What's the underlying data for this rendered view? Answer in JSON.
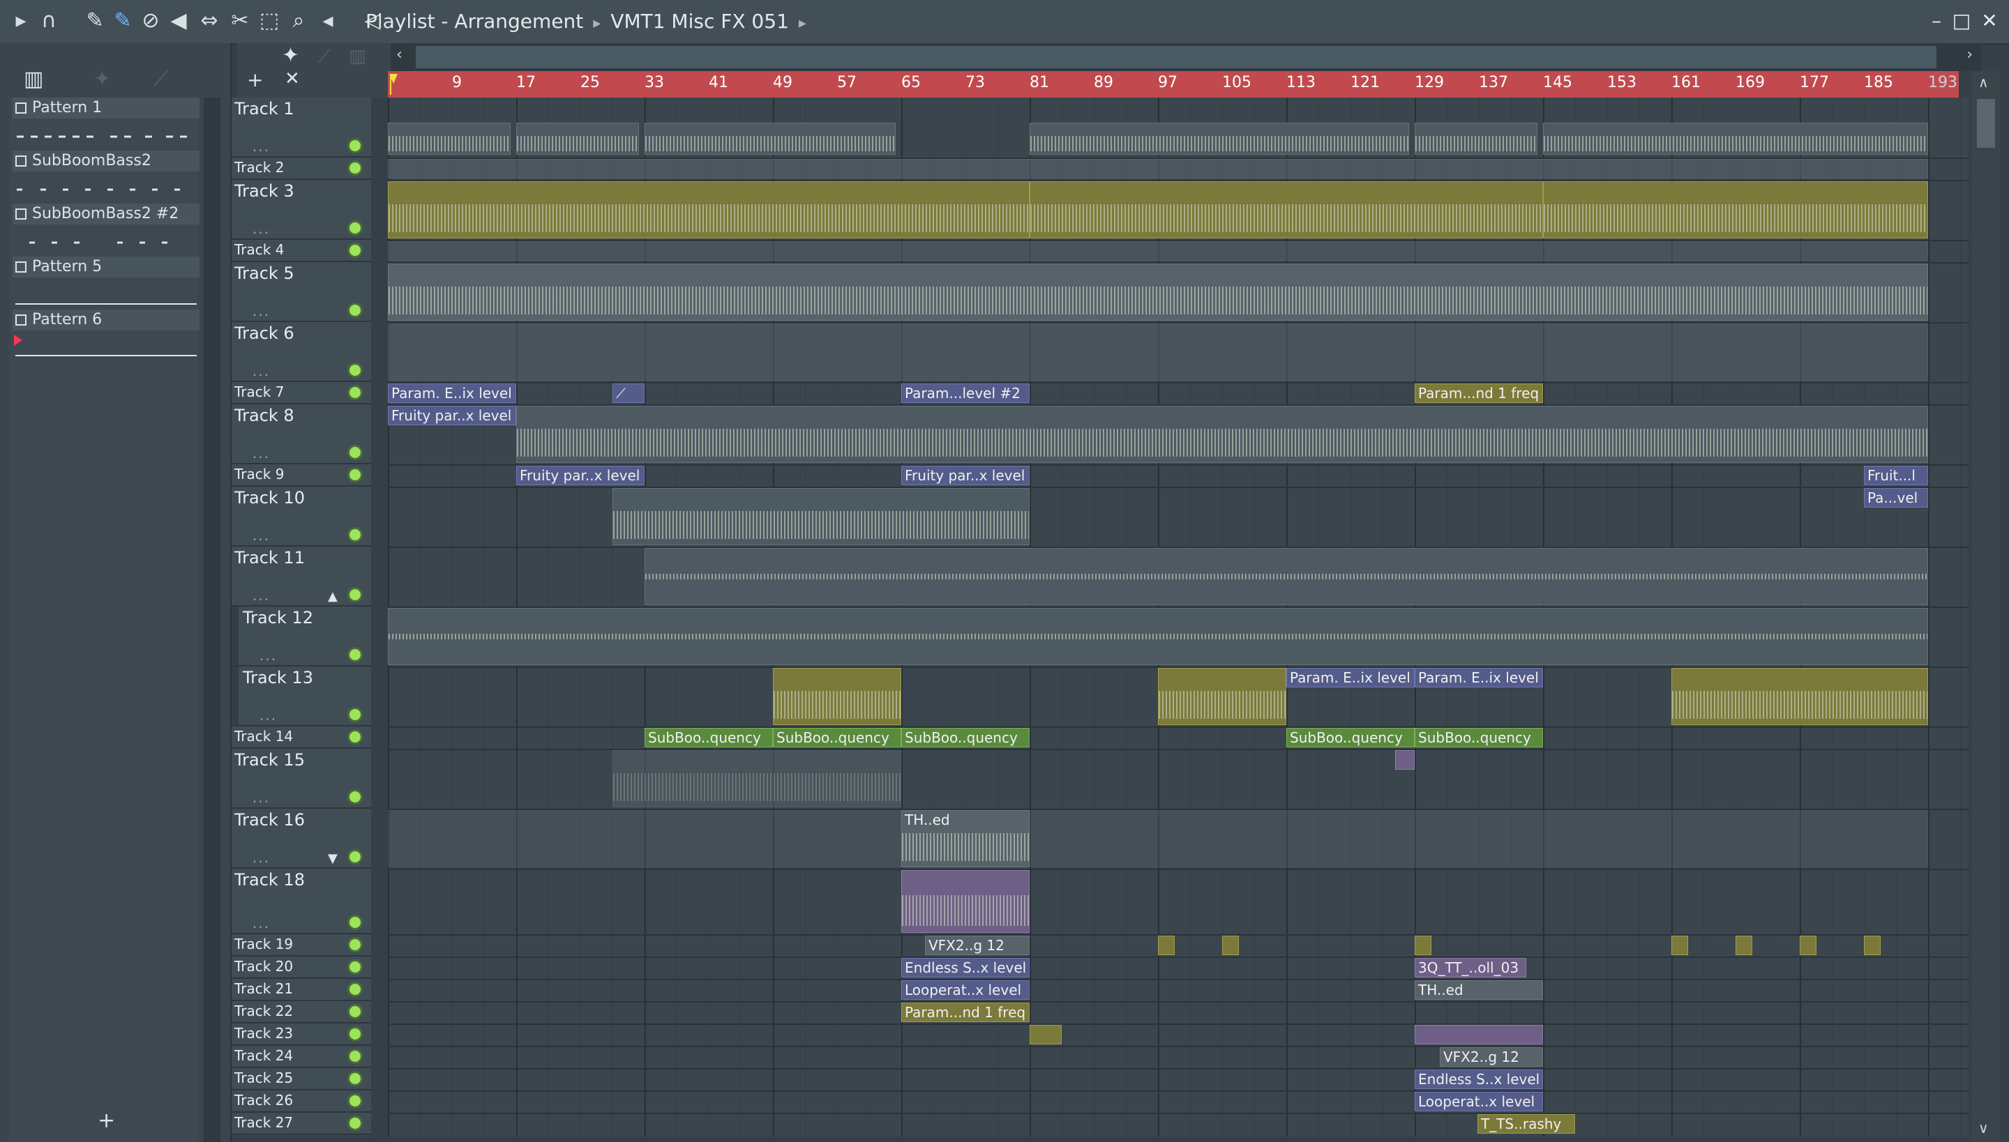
{
  "window": {
    "breadcrumb": [
      "Playlist - Arrangement",
      "VMT1 Misc FX 051"
    ],
    "controls": [
      "minimize",
      "maximize",
      "close"
    ]
  },
  "toolbar_icons": [
    "play-arrow-icon",
    "magnet-icon",
    "pencil-icon",
    "brush-icon",
    "delete-icon",
    "mute-icon",
    "slip-icon",
    "slice-icon",
    "select-icon",
    "zoom-icon",
    "playback-icon",
    "speaker-icon"
  ],
  "browser": {
    "patterns": [
      {
        "label": "Pattern 1"
      },
      {
        "label": "SubBoomBass2"
      },
      {
        "label": "SubBoomBass2 #2"
      },
      {
        "label": "Pattern 5"
      },
      {
        "label": "Pattern 6"
      }
    ],
    "add_label": "+"
  },
  "ruler": {
    "bars": [
      "9",
      "17",
      "25",
      "33",
      "41",
      "49",
      "57",
      "65",
      "73",
      "81",
      "89",
      "97",
      "105",
      "113",
      "121",
      "129",
      "137",
      "145",
      "153",
      "161",
      "169",
      "177",
      "185",
      "193"
    ]
  },
  "tracks": [
    {
      "label": "Track 1"
    },
    {
      "label": "Track 2"
    },
    {
      "label": "Track 3"
    },
    {
      "label": "Track 4"
    },
    {
      "label": "Track 5"
    },
    {
      "label": "Track 6"
    },
    {
      "label": "Track 7"
    },
    {
      "label": "Track 8"
    },
    {
      "label": "Track 9"
    },
    {
      "label": "Track 10"
    },
    {
      "label": "Track 11"
    },
    {
      "label": "Track 12"
    },
    {
      "label": "Track 13"
    },
    {
      "label": "Track 14"
    },
    {
      "label": "Track 15"
    },
    {
      "label": "Track 16"
    },
    {
      "label": "Track 18"
    },
    {
      "label": "Track 19"
    },
    {
      "label": "Track 20"
    },
    {
      "label": "Track 21"
    },
    {
      "label": "Track 22"
    },
    {
      "label": "Track 23"
    },
    {
      "label": "Track 24"
    },
    {
      "label": "Track 25"
    },
    {
      "label": "Track 26"
    },
    {
      "label": "Track 27"
    }
  ],
  "clips": {
    "t7_a": "Param. E..ix level",
    "t7_b": "Param...level #2",
    "t7_c": "Param...nd 1 freq",
    "t8_a": "Fruity par..x level",
    "t9_a": "Fruity par..x level",
    "t9_b": "Fruity par..x level",
    "t9_c": "Fruit...l",
    "t10_a": "Pa...vel",
    "t13_a": "Param. E..ix level",
    "t13_b": "Param. E..ix level",
    "t14_a": "SubBoo..quency",
    "t14_b": "SubBoo..quency",
    "t14_c": "SubBoo..quency",
    "t14_d": "SubBoo..quency",
    "t14_e": "SubBoo..quency",
    "t16_a": "TH..ed",
    "t19_a": "VFX2..g 12",
    "t20_a": "Endless S..x level",
    "t20_b": "3Q_TT_..oll_03",
    "t21_a": "Looperat..x level",
    "t21_b": "TH..ed",
    "t22_a": "Param...nd 1 freq",
    "t24_a": "VFX2..g 12",
    "t25_a": "Endless S..x level",
    "t26_a": "Looperat..x level",
    "t27_a": "T_TS..rashy"
  },
  "colors": {
    "ruler": "#c24a4f",
    "automation": "#535c8a",
    "green_clip": "#5a8a3e",
    "led": "#9be45c"
  }
}
